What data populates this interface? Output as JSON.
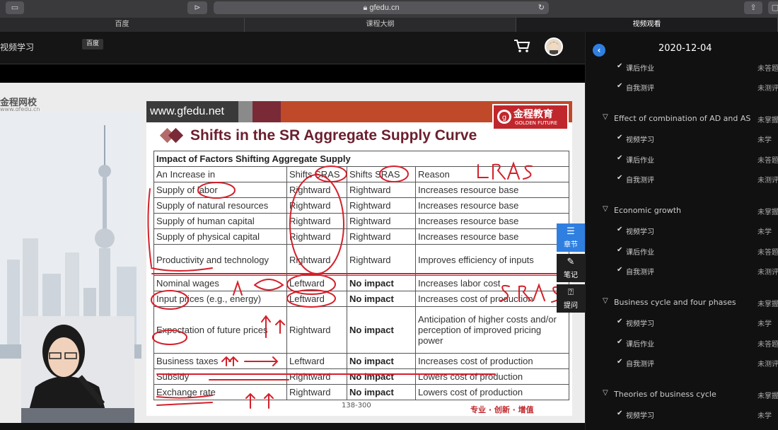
{
  "browser": {
    "url": "gfedu.cn",
    "tabs": [
      "百度",
      "课程大纲",
      "视频观看"
    ]
  },
  "app": {
    "title": "视频学习",
    "baidu_badge": "百度"
  },
  "video": {
    "logo": "金程网校",
    "logo_sub": "www.gfedu.cn",
    "slide": {
      "url": "www.gfedu.net",
      "brand_cn": "金程教育",
      "brand_en": "GOLDEN FUTURE",
      "title": "Shifts in the SR Aggregate Supply Curve",
      "table_title": "Impact of Factors Shifting Aggregate Supply",
      "headers": [
        "An Increase in",
        "Shifts SRAS",
        "Shifts SRAS",
        "Reason"
      ],
      "rows": [
        [
          "Supply of labor",
          "Rightward",
          "Rightward",
          "Increases resource base"
        ],
        [
          "Supply of natural resources",
          "Rightward",
          "Rightward",
          "Increases resource base"
        ],
        [
          "Supply of human capital",
          "Rightward",
          "Rightward",
          "Increases resource base"
        ],
        [
          "Supply of physical capital",
          "Rightward",
          "Rightward",
          "Increases resource base"
        ],
        [
          "Productivity and technology",
          "Rightward",
          "Rightward",
          "Improves efficiency of inputs"
        ],
        [
          "Nominal wages",
          "Leftward",
          "No impact",
          "Increases labor cost"
        ],
        [
          "Input prices (e.g., energy)",
          "Leftward",
          "No impact",
          "Increases cost of production"
        ],
        [
          "Expectation of future prices",
          "Rightward",
          "No impact",
          "Anticipation of higher costs and/or perception of improved pricing power"
        ],
        [
          "Business taxes",
          "Leftward",
          "No impact",
          "Increases cost of production"
        ],
        [
          "Subsidy",
          "Rightward",
          "No impact",
          "Lowers cost of production"
        ],
        [
          "Exchange rate",
          "Rightward",
          "No impact",
          "Lowers cost of production"
        ]
      ],
      "page": "138-300",
      "slogan": "专业 · 创新 · 增值"
    }
  },
  "side_buttons": [
    {
      "label": "章节",
      "icon": "list-icon"
    },
    {
      "label": "笔记",
      "icon": "pencil-icon"
    },
    {
      "label": "提问",
      "icon": "question-icon"
    }
  ],
  "panel": {
    "date": "2020-12-04",
    "sections": [
      {
        "title": "",
        "status": "",
        "items": [
          {
            "label": "课后作业",
            "status": "未答题"
          },
          {
            "label": "自我测评",
            "status": "未测评"
          }
        ]
      },
      {
        "title": "Effect of combination of AD and AS",
        "status": "未掌握",
        "items": [
          {
            "label": "视频学习",
            "status": "未学"
          },
          {
            "label": "课后作业",
            "status": "未答题"
          },
          {
            "label": "自我测评",
            "status": "未测评"
          }
        ]
      },
      {
        "title": "Economic growth",
        "status": "未掌握",
        "items": [
          {
            "label": "视频学习",
            "status": "未学"
          },
          {
            "label": "课后作业",
            "status": "未答题"
          },
          {
            "label": "自我测评",
            "status": "未测评"
          }
        ]
      },
      {
        "title": "Business cycle and four phases",
        "status": "未掌握",
        "items": [
          {
            "label": "视频学习",
            "status": "未学"
          },
          {
            "label": "课后作业",
            "status": "未答题"
          },
          {
            "label": "自我测评",
            "status": "未测评"
          }
        ]
      },
      {
        "title": "Theories of business cycle",
        "status": "未掌握",
        "items": [
          {
            "label": "视频学习",
            "status": "未学"
          }
        ]
      }
    ]
  }
}
